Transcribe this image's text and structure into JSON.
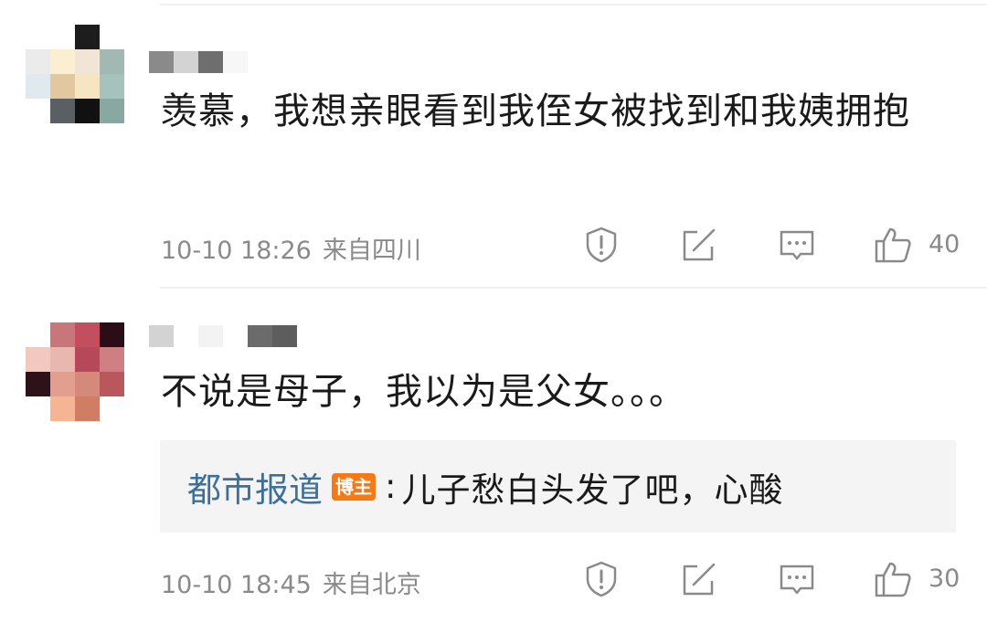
{
  "comments": [
    {
      "text": "羡慕，我想亲眼看到我侄女被找到和我姨拥抱",
      "time": "10-10 18:26",
      "location": "来自四川",
      "likes": "40",
      "avatar_colors": [
        "#ffffff",
        "#ffffff",
        "#1d1d1d",
        "#ffffff",
        "#ebebeb",
        "#fbeed1",
        "#f1e5d5",
        "#a1b9b2",
        "#e0eaee",
        "#e2c89e",
        "#f5e6c1",
        "#a5c2bd",
        "#ffffff",
        "#5a5f63",
        "#111111",
        "#8aa8a2"
      ],
      "username_colors": [
        "#8a8a8a",
        "#d3d3d3",
        "#6e6e6e",
        "#f7f7f7"
      ]
    },
    {
      "text": "不说是母子，我以为是父女。。。",
      "time": "10-10 18:45",
      "location": "来自北京",
      "likes": "30",
      "avatar_colors": [
        "#ffffff",
        "#c9767b",
        "#c34f5e",
        "#2a0d17",
        "#f3c8bf",
        "#e8b7ae",
        "#b5495a",
        "#cf7f82",
        "#2e1219",
        "#e29e8f",
        "#d4897b",
        "#b9575d",
        "#ffffff",
        "#f5b493",
        "#cf7d65",
        "#ffffff"
      ],
      "username_colors": [
        "#d3d3d3",
        "#ffffff",
        "#f3f3f3",
        "#ffffff",
        "#6b6b6b",
        "#5d5d5d"
      ],
      "reply": {
        "author": "都市报道",
        "badge": "博主",
        "separator": ":",
        "text": "儿子愁白头发了吧，心酸"
      }
    }
  ],
  "icons": [
    "report-icon",
    "share-icon",
    "comment-icon",
    "like-icon"
  ],
  "colors": {
    "link": "#3c6f9c",
    "badge": "#f47a18",
    "meta": "#8a8a8a",
    "reply_bg": "#f4f4f4"
  }
}
